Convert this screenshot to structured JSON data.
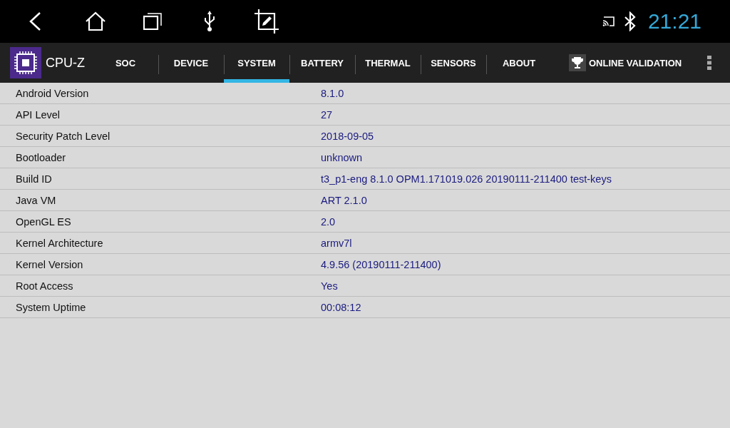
{
  "status_bar": {
    "time": "21:21"
  },
  "app_bar": {
    "title": "CPU-Z",
    "validation": "ONLINE VALIDATION"
  },
  "tabs": [
    {
      "label": "SOC",
      "selected": false
    },
    {
      "label": "DEVICE",
      "selected": false
    },
    {
      "label": "SYSTEM",
      "selected": true
    },
    {
      "label": "BATTERY",
      "selected": false
    },
    {
      "label": "THERMAL",
      "selected": false
    },
    {
      "label": "SENSORS",
      "selected": false
    },
    {
      "label": "ABOUT",
      "selected": false
    }
  ],
  "rows": [
    {
      "label": "Android Version",
      "value": "8.1.0"
    },
    {
      "label": "API Level",
      "value": "27"
    },
    {
      "label": "Security Patch Level",
      "value": "2018-09-05"
    },
    {
      "label": "Bootloader",
      "value": "unknown"
    },
    {
      "label": "Build ID",
      "value": "t3_p1-eng 8.1.0 OPM1.171019.026 20190111-211400 test-keys"
    },
    {
      "label": "Java VM",
      "value": "ART 2.1.0"
    },
    {
      "label": "OpenGL ES",
      "value": "2.0"
    },
    {
      "label": "Kernel Architecture",
      "value": "armv7l"
    },
    {
      "label": "Kernel Version",
      "value": "4.9.56 (20190111-211400)"
    },
    {
      "label": "Root Access",
      "value": "Yes"
    },
    {
      "label": "System Uptime",
      "value": "00:08:12"
    }
  ]
}
